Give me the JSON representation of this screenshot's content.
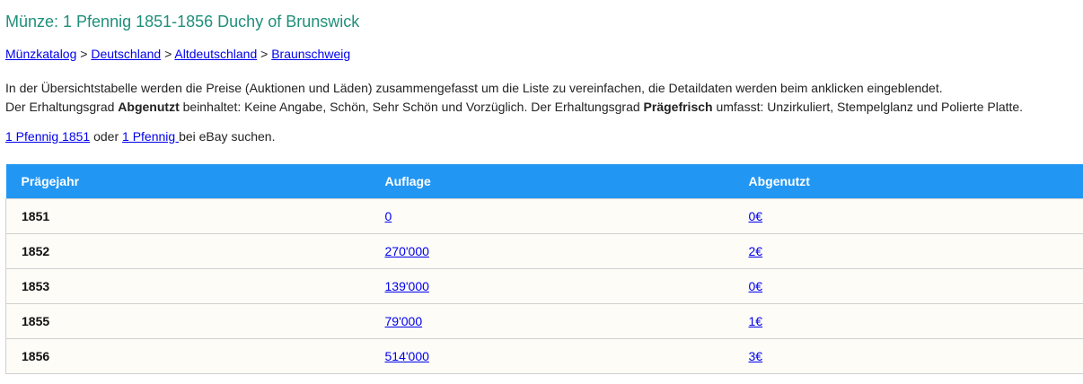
{
  "title": "Münze: 1 Pfennig 1851-1856 Duchy of Brunswick",
  "breadcrumb": {
    "items": [
      "Münzkatalog",
      "Deutschland",
      "Altdeutschland",
      "Braunschweig"
    ],
    "separator": ">"
  },
  "info": {
    "line1": "In der Übersichtstabelle werden die Preise (Auktionen und Läden) zusammengefasst um die Liste zu vereinfachen, die Detaildaten werden beim anklicken eingeblendet.",
    "line2_a": "Der Erhaltungsgrad ",
    "line2_b": "Abgenutzt",
    "line2_c": " beinhaltet: Keine Angabe, Schön, Sehr Schön und Vorzüglich. Der Erhaltungsgrad ",
    "line2_d": "Prägefrisch",
    "line2_e": " umfasst: Unzirkuliert, Stempelglanz und Polierte Platte."
  },
  "ebay": {
    "link1": "1 Pfennig 1851",
    "middle": " oder ",
    "link2": "1 Pfennig ",
    "suffix": "bei eBay suchen."
  },
  "table": {
    "headers": [
      "Prägejahr",
      "Auflage",
      "Abgenutzt"
    ],
    "rows": [
      {
        "year": "1851",
        "mintage": "0",
        "price": "0€"
      },
      {
        "year": "1852",
        "mintage": "270'000",
        "price": "2€"
      },
      {
        "year": "1853",
        "mintage": "139'000",
        "price": "0€"
      },
      {
        "year": "1855",
        "mintage": "79'000",
        "price": "1€"
      },
      {
        "year": "1856",
        "mintage": "514'000",
        "price": "3€"
      }
    ]
  },
  "colors": {
    "title": "#1f8f7a",
    "header_bg": "#2196f3",
    "link": "#0000ee",
    "row_bg": "#fdfcf7"
  }
}
